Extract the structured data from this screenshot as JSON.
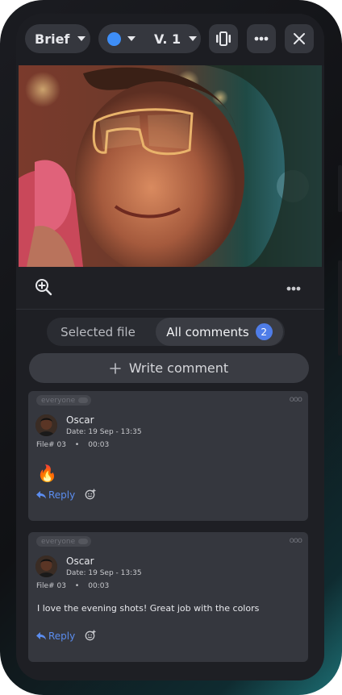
{
  "header": {
    "brief_label": "Brief",
    "status_color": "#3e8ef7",
    "version_label": "V. 1"
  },
  "tools": {},
  "tabs": {
    "selected_file": "Selected file",
    "all_comments": "All comments",
    "count": "2"
  },
  "write_comment_label": "Write comment",
  "comments": [
    {
      "audience": "everyone",
      "author": "Oscar",
      "date": "Date: 19 Sep - 13:35",
      "file": "File# 03",
      "time": "00:03",
      "body": "🔥",
      "reply_label": "Reply"
    },
    {
      "audience": "everyone",
      "author": "Oscar",
      "date": "Date: 19 Sep - 13:35",
      "file": "File# 03",
      "time": "00:03",
      "body": "I love the evening shots! Great job with the colors",
      "reply_label": "Reply"
    }
  ],
  "colors": {
    "accent": "#3e8ef7",
    "badge": "#4f7de8",
    "reply": "#5b8def"
  }
}
